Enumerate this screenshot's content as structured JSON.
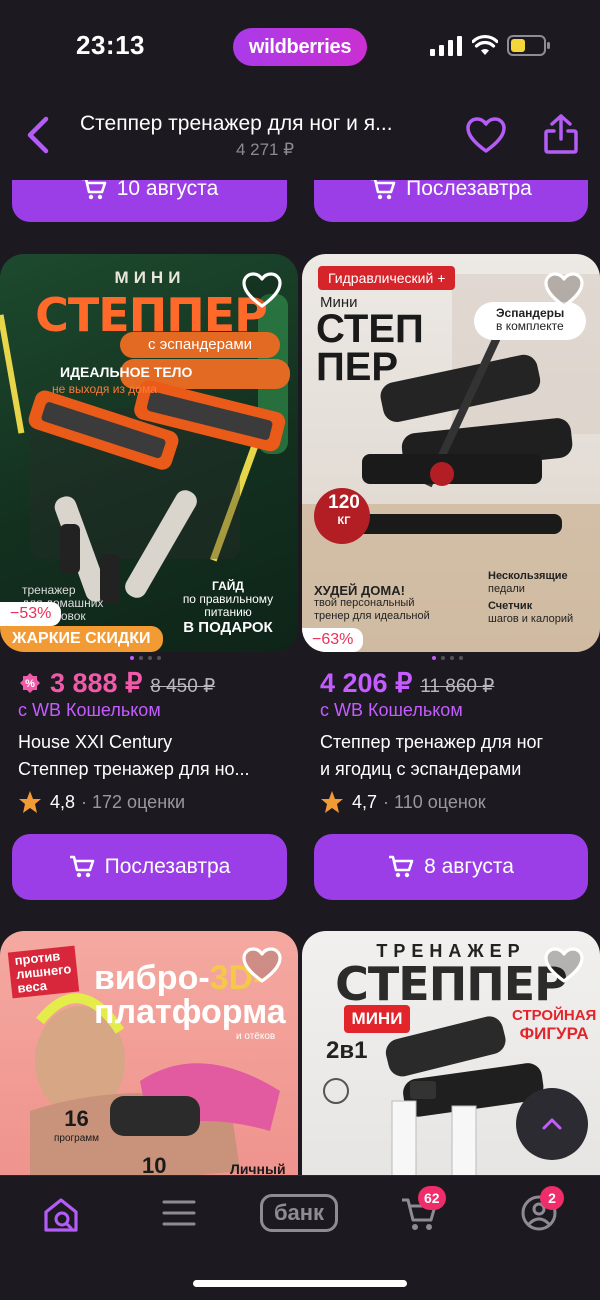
{
  "status": {
    "time": "23:13",
    "brand": "wildberries"
  },
  "header": {
    "title": "Степпер тренажер для ног и я...",
    "price": "4 271 ₽"
  },
  "top_buttons": [
    "10 августа",
    "Послезавтра"
  ],
  "products": [
    {
      "image": {
        "kicker": "МИНИ",
        "title": "СТЕППЕР",
        "subtitle": "с эспандерами",
        "line1": "ИДЕАЛЬНОЕ ТЕЛО",
        "line2": "не выходя из дома",
        "bl1": "тренажер",
        "bl2": "для домашних",
        "bl3": "тренировок",
        "br1": "ГАЙД",
        "br2": "по правильному",
        "br3": "питанию",
        "br4": "В ПОДАРОК"
      },
      "discount": "−53%",
      "promo": "ЖАРКИЕ СКИДКИ",
      "price": "3 888 ₽",
      "old_price": "8 450 ₽",
      "wallet": "с WB Кошельком",
      "name_line1": "House XXI Century",
      "name_line2": "Степпер тренажер для но...",
      "rating": "4,8",
      "reviews": "· 172 оценки",
      "button": "Послезавтра"
    },
    {
      "image": {
        "tag": "Гидравлический +",
        "kicker": "Мини",
        "title1": "СТЕП",
        "title2": "ПЕР",
        "badge1": "Эспандеры",
        "badge2": "в комплекте",
        "load": "120",
        "load_unit": "КГ",
        "left1": "ХУДЕЙ ДОМА!",
        "left2": "твой персональный",
        "left3": "тренер для идеальной",
        "right1": "Нескользящие",
        "right2": "педали",
        "right3": "Счетчик",
        "right4": "шагов и калорий"
      },
      "discount": "−63%",
      "price": "4 206 ₽",
      "old_price": "11 860 ₽",
      "wallet": "с WB Кошельком",
      "name_line1": "Степпер тренажер для ног",
      "name_line2": "и ягодиц с эспандерами",
      "rating": "4,7",
      "reviews": "· 110 оценок",
      "button": "8 августа"
    },
    {
      "image": {
        "tag1": "против",
        "tag2": "лишнего",
        "tag3": "веса",
        "t1": "вибро-",
        "t2": "3D-",
        "t3": "платформа",
        "small": "и отёков",
        "n1": "16",
        "n1l": "программ",
        "n2": "10",
        "n3": "Личный"
      }
    },
    {
      "image": {
        "top": "ТРЕНАЖЕР",
        "title": "СТЕППЕР",
        "mini": "МИНИ",
        "two": "2в1",
        "s1": "СТРОЙНАЯ",
        "s2": "ФИГУРА"
      }
    }
  ],
  "nav": {
    "bank": "банк",
    "cart_badge": "62",
    "profile_badge": "2"
  },
  "colors": {
    "accent": "#9b3ee8",
    "background": "#1c1a20",
    "price": "#c45cff",
    "sale": "#f05aa8"
  }
}
